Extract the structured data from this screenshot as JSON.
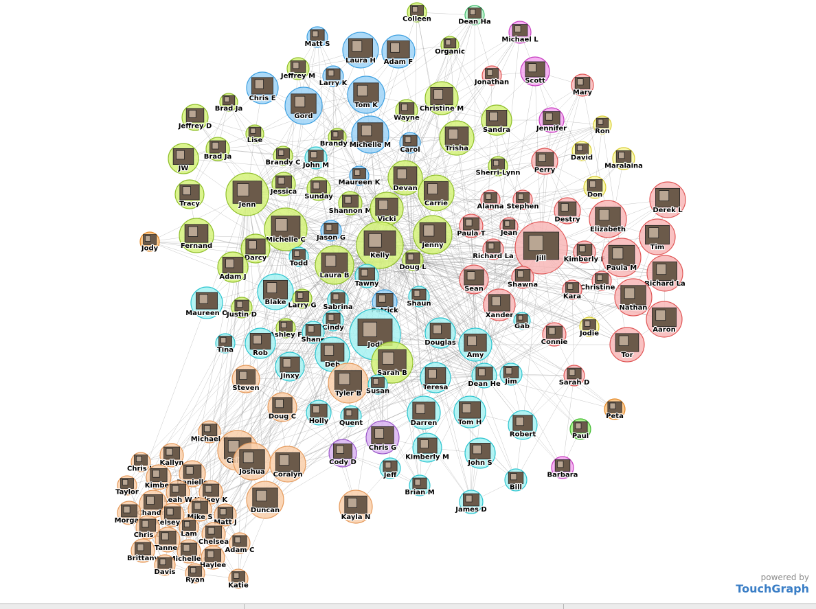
{
  "colors": {
    "group_green": "#d5f27a",
    "group_green_stroke": "#8fbf2a",
    "group_blue": "#9fd3f7",
    "group_blue_stroke": "#3c9fe0",
    "group_cyan": "#a7f2f2",
    "group_cyan_stroke": "#2cc4cf",
    "group_red": "#f8b7b7",
    "group_red_stroke": "#e05555",
    "group_peach": "#f9cfaa",
    "group_peach_stroke": "#e59a5c",
    "group_purple": "#d9b4f0",
    "group_purple_stroke": "#9a55c9",
    "group_magenta": "#f4a6f0",
    "group_magenta_stroke": "#c53dbf",
    "group_yellow": "#f9f7a0",
    "group_yellow_stroke": "#d8cc33",
    "group_orange": "#fbc07a",
    "group_orange_stroke": "#e28725",
    "group_mint": "#b6f2c8",
    "group_mint_stroke": "#3fb86a",
    "group_lime": "#9ef27a",
    "group_lime_stroke": "#3fb82e",
    "edge": "#8a8a8a",
    "brand": "#3a7ec6"
  },
  "branding": {
    "powered_by": "powered by",
    "brand": "TouchGraph"
  },
  "nodes": [
    {
      "label": "Colleen",
      "group": "green"
    },
    {
      "label": "Dean Ha",
      "group": "mint"
    },
    {
      "label": "Michael L",
      "group": "magenta"
    },
    {
      "label": "Matt S",
      "group": "blue"
    },
    {
      "label": "Laura H",
      "group": "blue"
    },
    {
      "label": "Adam F",
      "group": "blue"
    },
    {
      "label": "Organic",
      "group": "green"
    },
    {
      "label": "Scott",
      "group": "magenta"
    },
    {
      "label": "Jonathan",
      "group": "red"
    },
    {
      "label": "Jeffrey M",
      "group": "green"
    },
    {
      "label": "Larry K",
      "group": "blue"
    },
    {
      "label": "Mary",
      "group": "red"
    },
    {
      "label": "Chris E",
      "group": "blue"
    },
    {
      "label": "Tom K",
      "group": "blue"
    },
    {
      "label": "Christine M",
      "group": "green"
    },
    {
      "label": "Brad Ja",
      "group": "green"
    },
    {
      "label": "Gord",
      "group": "blue"
    },
    {
      "label": "Wayne",
      "group": "green"
    },
    {
      "label": "Jeffrey D",
      "group": "green"
    },
    {
      "label": "Sandra",
      "group": "green"
    },
    {
      "label": "Jennifer",
      "group": "magenta"
    },
    {
      "label": "Ron",
      "group": "yellow"
    },
    {
      "label": "Lise",
      "group": "green"
    },
    {
      "label": "Brandy F",
      "group": "green"
    },
    {
      "label": "Michelle M",
      "group": "blue"
    },
    {
      "label": "Trisha",
      "group": "green"
    },
    {
      "label": "Brad Ja",
      "group": "green"
    },
    {
      "label": "Carol",
      "group": "blue"
    },
    {
      "label": "David",
      "group": "yellow"
    },
    {
      "label": "JW",
      "group": "green"
    },
    {
      "label": "Brandy C",
      "group": "green"
    },
    {
      "label": "John M",
      "group": "cyan"
    },
    {
      "label": "Sherri-Lynn",
      "group": "green"
    },
    {
      "label": "Perry",
      "group": "red"
    },
    {
      "label": "Maralaina",
      "group": "yellow"
    },
    {
      "label": "Maureen K",
      "group": "blue"
    },
    {
      "label": "Jessica",
      "group": "green"
    },
    {
      "label": "Devan",
      "group": "green"
    },
    {
      "label": "Don",
      "group": "yellow"
    },
    {
      "label": "Sunday",
      "group": "green"
    },
    {
      "label": "Tracy",
      "group": "green"
    },
    {
      "label": "Jenn",
      "group": "green"
    },
    {
      "label": "Shannon M",
      "group": "green"
    },
    {
      "label": "Carrie",
      "group": "green"
    },
    {
      "label": "Alanna",
      "group": "red"
    },
    {
      "label": "Stephen",
      "group": "red"
    },
    {
      "label": "Derek L",
      "group": "red"
    },
    {
      "label": "Vicki",
      "group": "green"
    },
    {
      "label": "Destry",
      "group": "red"
    },
    {
      "label": "Elizabeth",
      "group": "red"
    },
    {
      "label": "Fernand",
      "group": "green"
    },
    {
      "label": "Jody",
      "group": "orange"
    },
    {
      "label": "Michelle C",
      "group": "green"
    },
    {
      "label": "Jason G",
      "group": "blue"
    },
    {
      "label": "Jenny",
      "group": "green"
    },
    {
      "label": "Paula T",
      "group": "red"
    },
    {
      "label": "Jean",
      "group": "red"
    },
    {
      "label": "Tim",
      "group": "red"
    },
    {
      "label": "Darcy",
      "group": "green"
    },
    {
      "label": "Kelly",
      "group": "green"
    },
    {
      "label": "Todd",
      "group": "cyan"
    },
    {
      "label": "Richard La",
      "group": "red"
    },
    {
      "label": "Jill",
      "group": "red"
    },
    {
      "label": "Kimberly F",
      "group": "red"
    },
    {
      "label": "Adam J",
      "group": "green"
    },
    {
      "label": "Laura B",
      "group": "green"
    },
    {
      "label": "Doug L",
      "group": "green"
    },
    {
      "label": "Paula M",
      "group": "red"
    },
    {
      "label": "Richard La",
      "group": "red"
    },
    {
      "label": "Tawny",
      "group": "cyan"
    },
    {
      "label": "Sean",
      "group": "red"
    },
    {
      "label": "Shawna",
      "group": "red"
    },
    {
      "label": "Christine O",
      "group": "red"
    },
    {
      "label": "Blake",
      "group": "cyan"
    },
    {
      "label": "Kara",
      "group": "red"
    },
    {
      "label": "Larry G",
      "group": "green"
    },
    {
      "label": "Sabrina",
      "group": "cyan"
    },
    {
      "label": "Shaun",
      "group": "cyan"
    },
    {
      "label": "Nathan",
      "group": "red"
    },
    {
      "label": "Maureen O",
      "group": "cyan"
    },
    {
      "label": "Justin D",
      "group": "green"
    },
    {
      "label": "Xander",
      "group": "red"
    },
    {
      "label": "Patrick",
      "group": "blue"
    },
    {
      "label": "Cindy",
      "group": "cyan"
    },
    {
      "label": "Gab",
      "group": "cyan"
    },
    {
      "label": "Aaron",
      "group": "red"
    },
    {
      "label": "Ashley F",
      "group": "green"
    },
    {
      "label": "Jodie",
      "group": "yellow"
    },
    {
      "label": "Shane",
      "group": "cyan"
    },
    {
      "label": "Douglas",
      "group": "cyan"
    },
    {
      "label": "Connie",
      "group": "red"
    },
    {
      "label": "Tina",
      "group": "cyan"
    },
    {
      "label": "Rob",
      "group": "cyan"
    },
    {
      "label": "Jodi",
      "group": "cyan"
    },
    {
      "label": "Amy",
      "group": "cyan"
    },
    {
      "label": "Tor",
      "group": "red"
    },
    {
      "label": "Deb",
      "group": "cyan"
    },
    {
      "label": "Jinxy",
      "group": "cyan"
    },
    {
      "label": "Sarah B",
      "group": "green"
    },
    {
      "label": "Dean He",
      "group": "cyan"
    },
    {
      "label": "Jim",
      "group": "cyan"
    },
    {
      "label": "Steven",
      "group": "peach"
    },
    {
      "label": "Teresa",
      "group": "cyan"
    },
    {
      "label": "Sarah D",
      "group": "red"
    },
    {
      "label": "Tyler B",
      "group": "peach"
    },
    {
      "label": "Susan",
      "group": "cyan"
    },
    {
      "label": "Doug C",
      "group": "peach"
    },
    {
      "label": "Peta",
      "group": "orange"
    },
    {
      "label": "Holly",
      "group": "cyan"
    },
    {
      "label": "Quent",
      "group": "cyan"
    },
    {
      "label": "Darren",
      "group": "cyan"
    },
    {
      "label": "Tom H",
      "group": "cyan"
    },
    {
      "label": "Robert",
      "group": "cyan"
    },
    {
      "label": "Paul",
      "group": "lime"
    },
    {
      "label": "Michael K",
      "group": "peach"
    },
    {
      "label": "Chris G",
      "group": "purple"
    },
    {
      "label": "Kimberly M",
      "group": "cyan"
    },
    {
      "label": "Caitly",
      "group": "peach"
    },
    {
      "label": "Cody D",
      "group": "purple"
    },
    {
      "label": "John S",
      "group": "cyan"
    },
    {
      "label": "Kallyn",
      "group": "peach"
    },
    {
      "label": "Joshua",
      "group": "peach"
    },
    {
      "label": "Coralyn",
      "group": "peach"
    },
    {
      "label": "Barbara",
      "group": "magenta"
    },
    {
      "label": "Chris K",
      "group": "peach"
    },
    {
      "label": "Danielle",
      "group": "peach"
    },
    {
      "label": "Kimber",
      "group": "peach"
    },
    {
      "label": "Jeff",
      "group": "cyan"
    },
    {
      "label": "Taylor",
      "group": "peach"
    },
    {
      "label": "Bill",
      "group": "cyan"
    },
    {
      "label": "Brian M",
      "group": "cyan"
    },
    {
      "label": "Leah W",
      "group": "peach"
    },
    {
      "label": "Kelsey K",
      "group": "peach"
    },
    {
      "label": "Chandra",
      "group": "peach"
    },
    {
      "label": "Duncan",
      "group": "peach"
    },
    {
      "label": "Kayla N",
      "group": "peach"
    },
    {
      "label": "Mike S",
      "group": "peach"
    },
    {
      "label": "Morgan",
      "group": "peach"
    },
    {
      "label": "Kelsey W",
      "group": "peach"
    },
    {
      "label": "Matt J",
      "group": "peach"
    },
    {
      "label": "James D",
      "group": "cyan"
    },
    {
      "label": "Chris D",
      "group": "peach"
    },
    {
      "label": "Lam",
      "group": "peach"
    },
    {
      "label": "Chelsea",
      "group": "peach"
    },
    {
      "label": "Tanner",
      "group": "peach"
    },
    {
      "label": "Adam C",
      "group": "peach"
    },
    {
      "label": "Brittany",
      "group": "peach"
    },
    {
      "label": "Michelle G",
      "group": "peach"
    },
    {
      "label": "Haylee",
      "group": "peach"
    },
    {
      "label": "Davis",
      "group": "peach"
    },
    {
      "label": "Ryan",
      "group": "peach"
    },
    {
      "label": "Katie",
      "group": "peach"
    }
  ]
}
